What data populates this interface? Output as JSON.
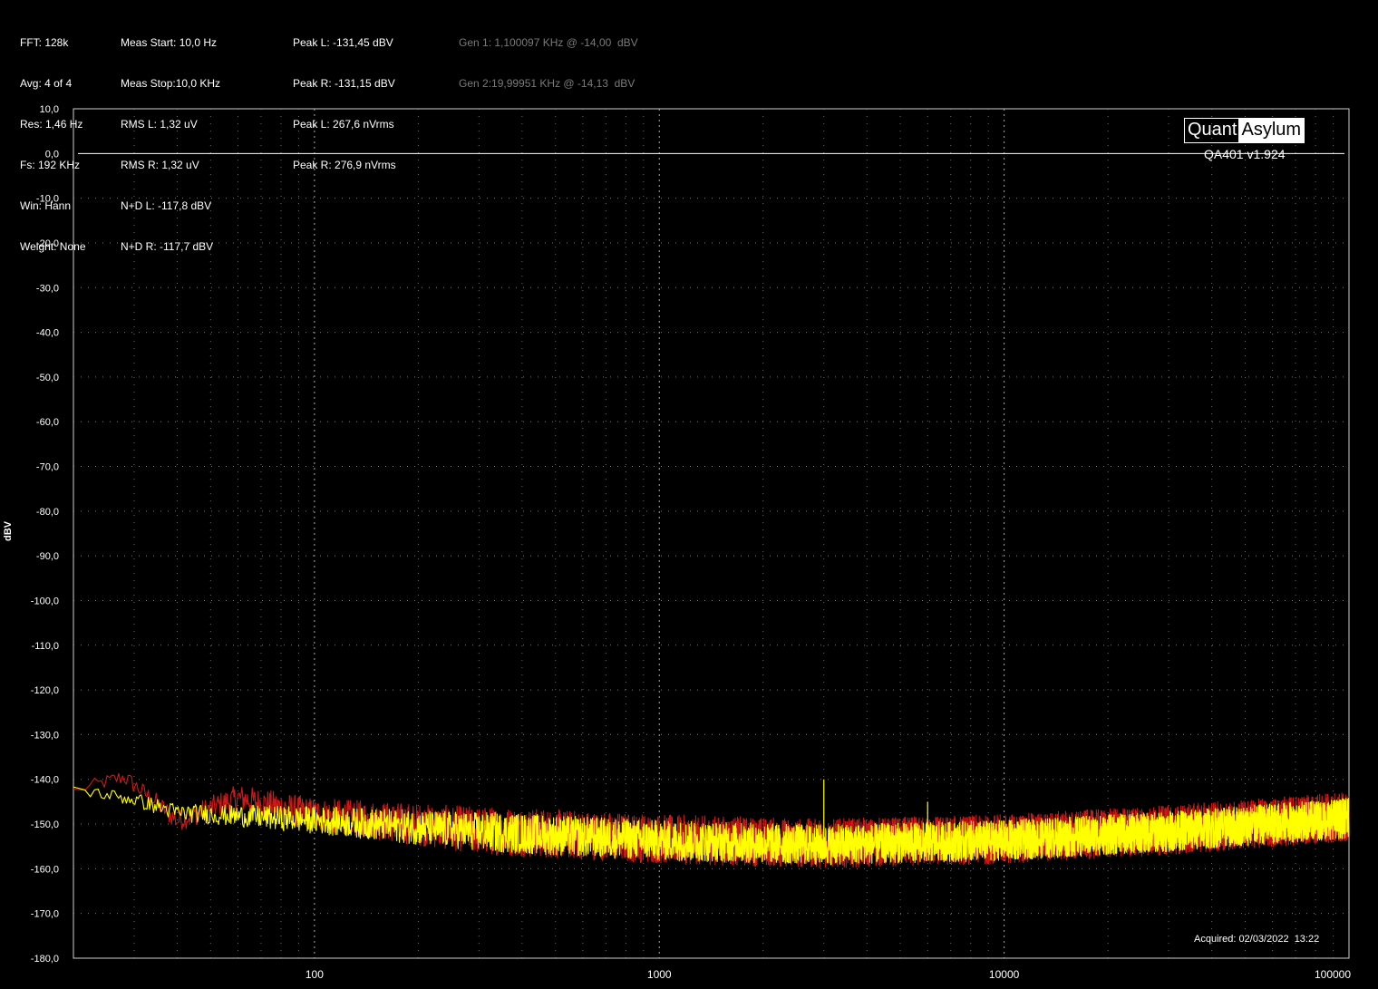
{
  "header": {
    "col1": [
      "FFT: 128k",
      "Avg: 4 of 4",
      "Res: 1,46 Hz",
      "Fs: 192 KHz",
      "Win: Hann",
      "Weight: None"
    ],
    "col2": [
      "Meas Start: 10,0 Hz",
      "Meas Stop:10,0 KHz",
      "RMS L: 1,32 uV",
      "RMS R: 1,32 uV",
      "N+D L: -117,8 dBV",
      "N+D R: -117,7 dBV"
    ],
    "col3": [
      "Peak L: -131,45 dBV",
      "Peak R: -131,15 dBV",
      "Peak L: 267,6 nVrms",
      "Peak R: 276,9 nVrms"
    ],
    "col4": [
      "Gen 1: 1,100097 KHz @ -14,00  dBV",
      "Gen 2:19,99951 KHz @ -14,13  dBV"
    ]
  },
  "logo": {
    "left": "Quant",
    "right": "Asylum"
  },
  "version": "QA401 v1.924",
  "acquired": "Acquired: 02/03/2022  13:22",
  "colors": {
    "background": "#000000",
    "left_channel": "#ffff00",
    "right_channel": "#cc1a1a",
    "grid": "#9a9a9a",
    "reference_line": "#ffffff"
  },
  "chart_data": {
    "type": "line",
    "xscale": "log",
    "xlim": [
      20,
      100000
    ],
    "ylim": [
      -180,
      10
    ],
    "ylabel": "dBV",
    "xlabel": "",
    "x_tick_labels": [
      "100",
      "1000",
      "10000",
      "100000"
    ],
    "y_tick_labels": [
      "10,0",
      "0,0",
      "-10,0",
      "-20,0",
      "-30,0",
      "-40,0",
      "-50,0",
      "-60,0",
      "-70,0",
      "-80,0",
      "-90,0",
      "-100,0",
      "-110,0",
      "-120,0",
      "-130,0",
      "-140,0",
      "-150,0",
      "-160,0",
      "-170,0",
      "-180,0"
    ],
    "grid": true,
    "reference_line_dbv": 0,
    "series": [
      {
        "channel": "L",
        "color": "#ffff00",
        "noise_floor_points": [
          [
            20,
            -142.5
          ],
          [
            30,
            -145
          ],
          [
            40,
            -148
          ],
          [
            100,
            -150
          ],
          [
            300,
            -153
          ],
          [
            1000,
            -155
          ],
          [
            3000,
            -156
          ],
          [
            10000,
            -155
          ],
          [
            30000,
            -153
          ],
          [
            100000,
            -150
          ]
        ],
        "spread_db": 9,
        "spurs": [
          [
            3000,
            -140
          ],
          [
            6000,
            -145
          ]
        ]
      },
      {
        "channel": "R",
        "color": "#cc1a1a",
        "noise_floor_points": [
          [
            20,
            -143
          ],
          [
            28,
            -140
          ],
          [
            35,
            -146
          ],
          [
            40,
            -150
          ],
          [
            60,
            -145
          ],
          [
            100,
            -149
          ],
          [
            300,
            -153
          ],
          [
            1000,
            -155
          ],
          [
            3000,
            -156
          ],
          [
            10000,
            -155
          ],
          [
            30000,
            -153
          ],
          [
            100000,
            -150
          ]
        ],
        "spread_db": 11,
        "spurs": []
      }
    ]
  }
}
